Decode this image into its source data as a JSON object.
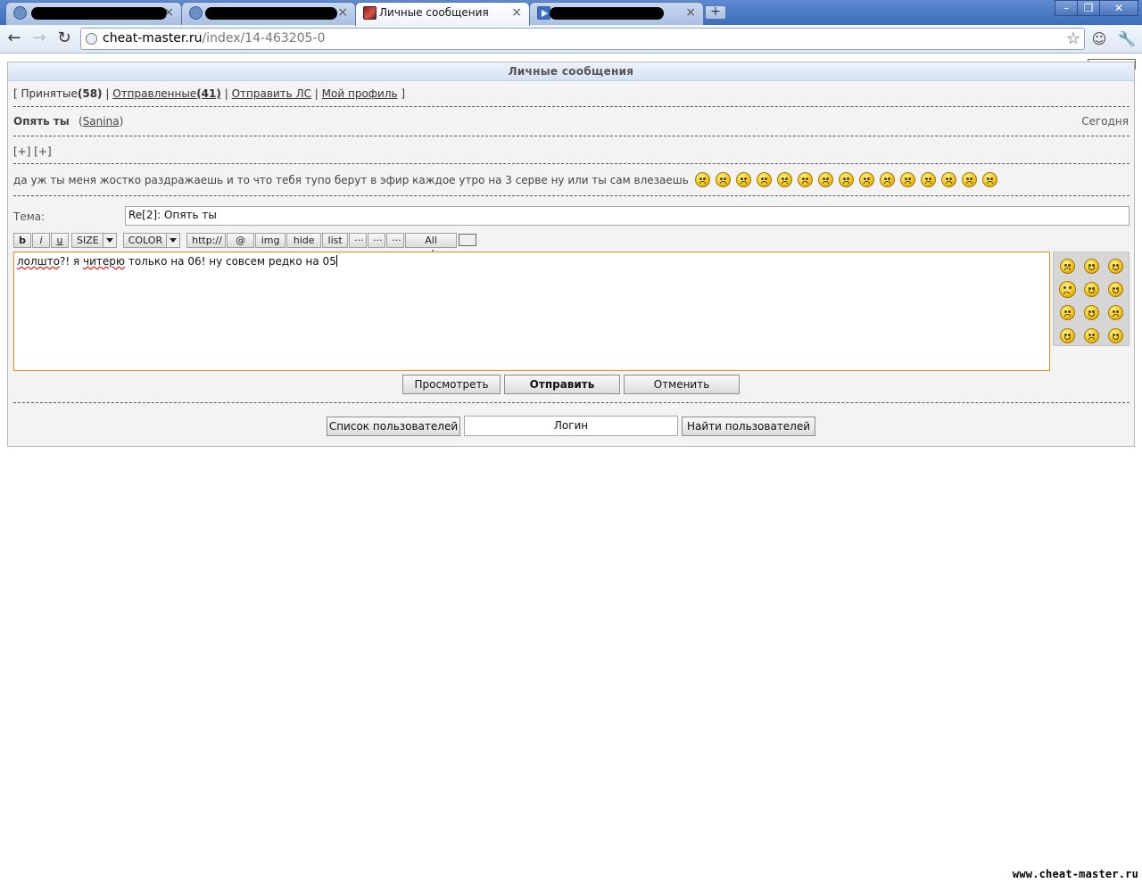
{
  "browser": {
    "tabs": [
      {
        "label": "",
        "redacted": true
      },
      {
        "label": "",
        "redacted": true
      },
      {
        "label": "Личные сообщения",
        "redacted": false
      },
      {
        "label": "",
        "redacted": true
      }
    ],
    "url_host": "cheat-master.ru",
    "url_path": "/index/14-463205-0",
    "icons": [
      "back-icon",
      "forward-icon",
      "reload-icon",
      "bookmark-star-icon",
      "page-menu-icon",
      "wrench-icon",
      "minimize-icon",
      "maximize-icon",
      "close-icon",
      "new-tab-icon"
    ]
  },
  "page": {
    "header_title": "Личные сообщения",
    "nav": {
      "open_bracket": "[",
      "inbox_label": "Принятые",
      "inbox_count": "(58)",
      "sent_label": "Отправленные",
      "sent_count": "(41)",
      "send_label": "Отправить ЛС",
      "profile_label": "Мой профиль",
      "close_bracket": "]",
      "separator": "|"
    },
    "message": {
      "subject": "Опять ты",
      "author_open": "(",
      "author": "Sanina",
      "author_close": ")",
      "date": "Сегодня",
      "expand_1": "[+]",
      "expand_2": "[+]",
      "body": "да уж ты меня жостко раздражаешь и то что тебя тупо берут в эфир каждое утро на 3 серве ну или ты сам влезаешь",
      "angry_smiley_count": 15
    },
    "reply": {
      "subject_label": "Тема:",
      "subject_value": "Re[2]: Опять ты",
      "toolbar": {
        "bold": "b",
        "italic": "i",
        "underline": "u",
        "size": "SIZE",
        "color": "COLOR",
        "url": "http://",
        "email": "@",
        "img": "img",
        "hide": "hide",
        "list": "list",
        "more1": "···",
        "more2": "···",
        "more3": "···",
        "all_codes": "All codes"
      },
      "text_word1": "лолшто",
      "text_part2": "?! я ",
      "text_word2": "читерю",
      "text_part3": " только на 06! ну совсем редко на 05",
      "buttons": {
        "preview": "Просмотреть",
        "send": "Отправить",
        "cancel": "Отменить"
      }
    },
    "users": {
      "list_button": "Список пользователей",
      "login_placeholder": "Логин",
      "find_button": "Найти пользователей"
    },
    "watermark": "www.cheat-master.ru"
  }
}
